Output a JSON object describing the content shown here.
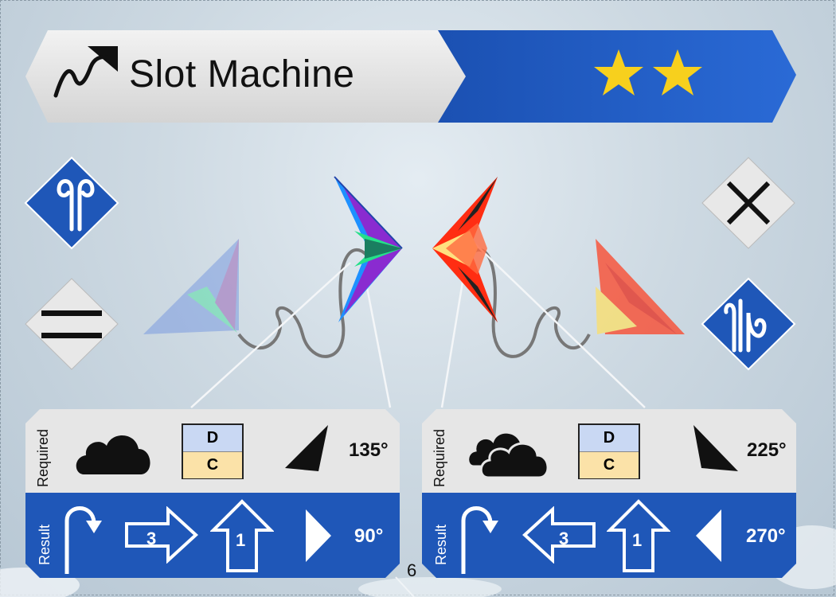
{
  "header": {
    "title": "Slot Machine",
    "stars": 2,
    "colors": {
      "banner_blue": "#1f57b8",
      "banner_light": "#e6e6e6",
      "star": "#f7d01d"
    }
  },
  "side_buttons": {
    "top_left": {
      "icon": "wind-gust-icon"
    },
    "bottom_left": {
      "icon": "equals-lines-icon"
    },
    "top_right": {
      "icon": "close-icon"
    },
    "bottom_right": {
      "icon": "strong-wind-icon"
    }
  },
  "cards": [
    {
      "required_label": "Required",
      "result_label": "Result",
      "weather_icon": "cloud-icon",
      "dc_top": "D",
      "dc_bottom": "C",
      "required_angle": "135°",
      "move_step_1": "3",
      "move_step_2": "1",
      "result_angle": "90°",
      "move_direction": "right"
    },
    {
      "required_label": "Required",
      "result_label": "Result",
      "weather_icon": "double-cloud-icon",
      "dc_top": "D",
      "dc_bottom": "C",
      "required_angle": "225°",
      "move_step_1": "3",
      "move_step_2": "1",
      "result_angle": "270°",
      "move_direction": "left"
    }
  ],
  "page_number": "6"
}
